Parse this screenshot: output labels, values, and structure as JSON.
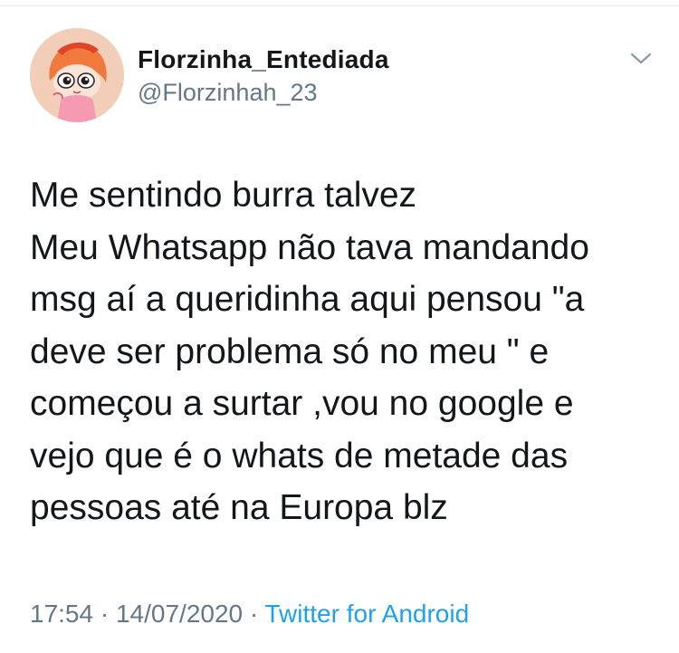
{
  "author": {
    "display_name": "Florzinha_Entediada",
    "handle": "@Florzinhah_23",
    "avatar_icon": "powerpuff-blossom-avatar"
  },
  "menu": {
    "icon": "chevron-down-icon"
  },
  "tweet": {
    "lines": [
      "Me sentindo burra talvez",
      "Meu Whatsapp não tava mandando",
      "msg aí a queridinha aqui pensou \"a",
      "deve ser problema só no meu \" e",
      "começou a surtar ,vou no google e",
      "vejo que é o whats de metade das",
      "pessoas até na Europa blz"
    ]
  },
  "meta": {
    "time": "17:54",
    "separator": " · ",
    "date": "14/07/2020",
    "source": "Twitter for Android"
  },
  "colors": {
    "text": "#14171a",
    "secondary": "#657786",
    "link": "#1da1f2"
  }
}
